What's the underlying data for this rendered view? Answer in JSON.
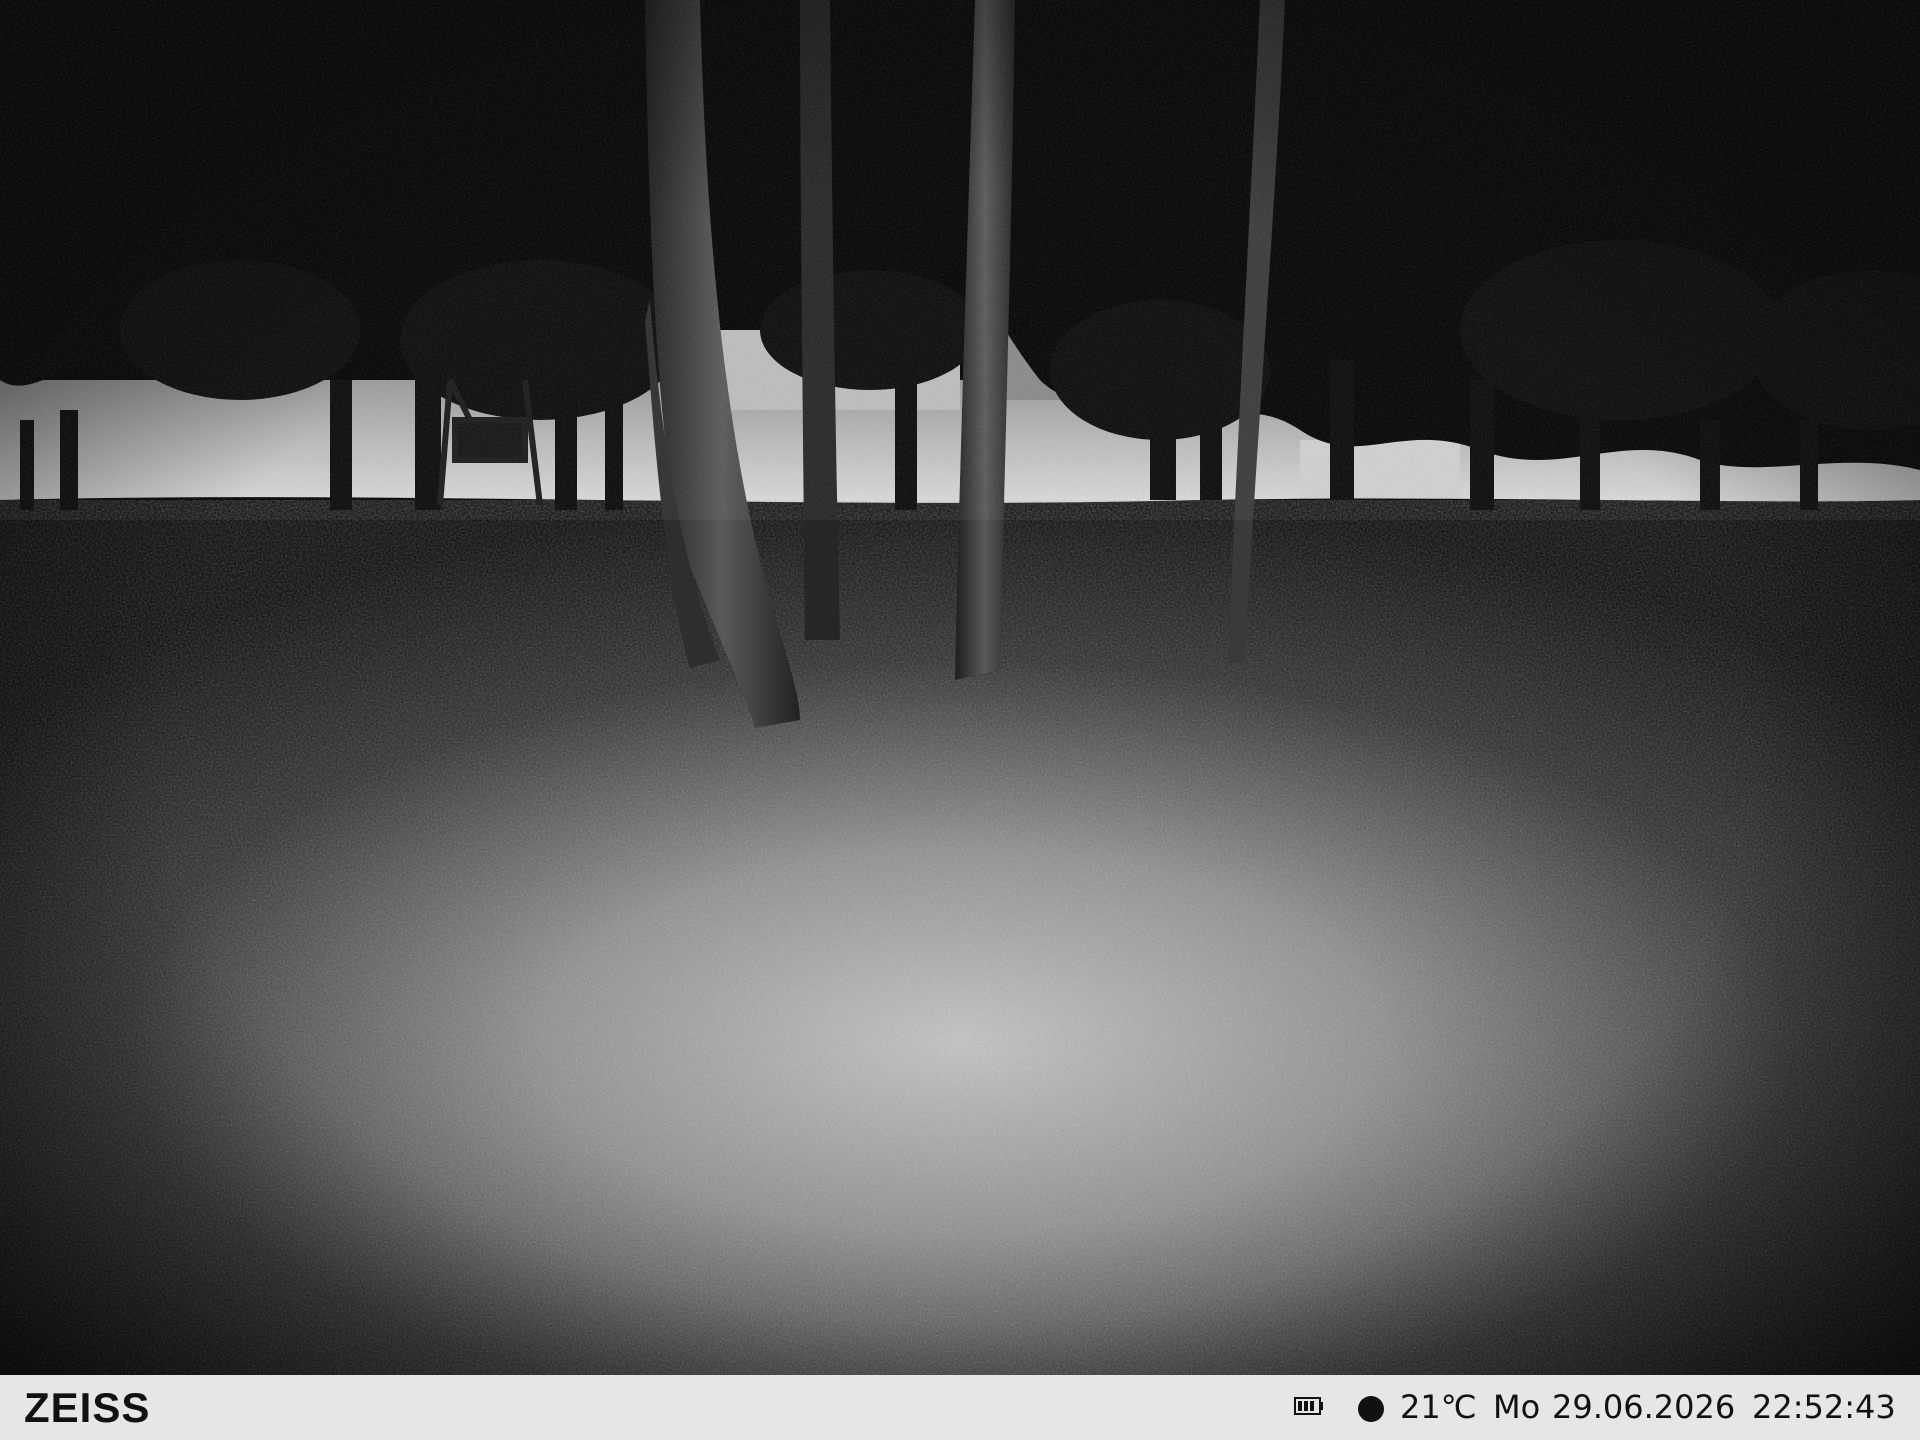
{
  "scene": {
    "description_icon": "night-forest-photo",
    "palette": {
      "sky": "#d9d9d9",
      "foliage": "#050505",
      "ground_lit": "#bdbdbd",
      "ground_dark": "#0a0a0a",
      "trunk": "#4a4a4a"
    }
  },
  "info_bar": {
    "brand": "ZEISS",
    "battery_icon": "battery-icon",
    "record_icon": "record-dot-icon",
    "temperature": "21℃",
    "weekday": "Mo",
    "date": "29.06.2026",
    "time": "22:52:43",
    "background": "#e6e6e6",
    "text_color": "#111111"
  }
}
